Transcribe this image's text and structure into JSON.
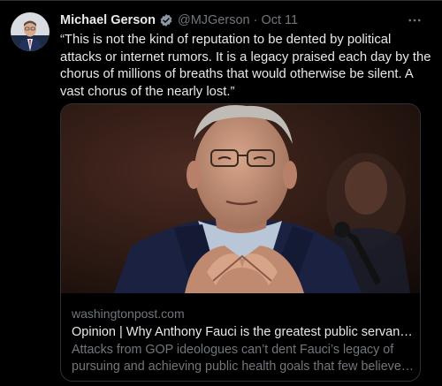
{
  "tweet": {
    "author_name": "Michael Gerson",
    "handle": "@MJGerson",
    "separator": "·",
    "date": "Oct 11",
    "verified_icon": "verified-badge-icon",
    "more_icon": "more-options-icon",
    "text": "“This is not the kind of reputation to be dented by political attacks or internet rumors. It is a legacy praised each day by the chorus of millions of breaths that would otherwise be silent. A vast chorus of the nearly lost.”"
  },
  "card": {
    "domain": "washingtonpost.com",
    "title": "Opinion | Why Anthony Fauci is the greatest public servant I ...",
    "description_line1": "Attacks from GOP ideologues can’t dent Fauci’s legacy of",
    "description_line2": "pursuing and achieving public health goals that few believed..."
  },
  "colors": {
    "background": "#000000",
    "text_primary": "#e7e9ea",
    "text_secondary": "#71767b",
    "border": "#2f3336",
    "verified": "#8b98a5"
  }
}
